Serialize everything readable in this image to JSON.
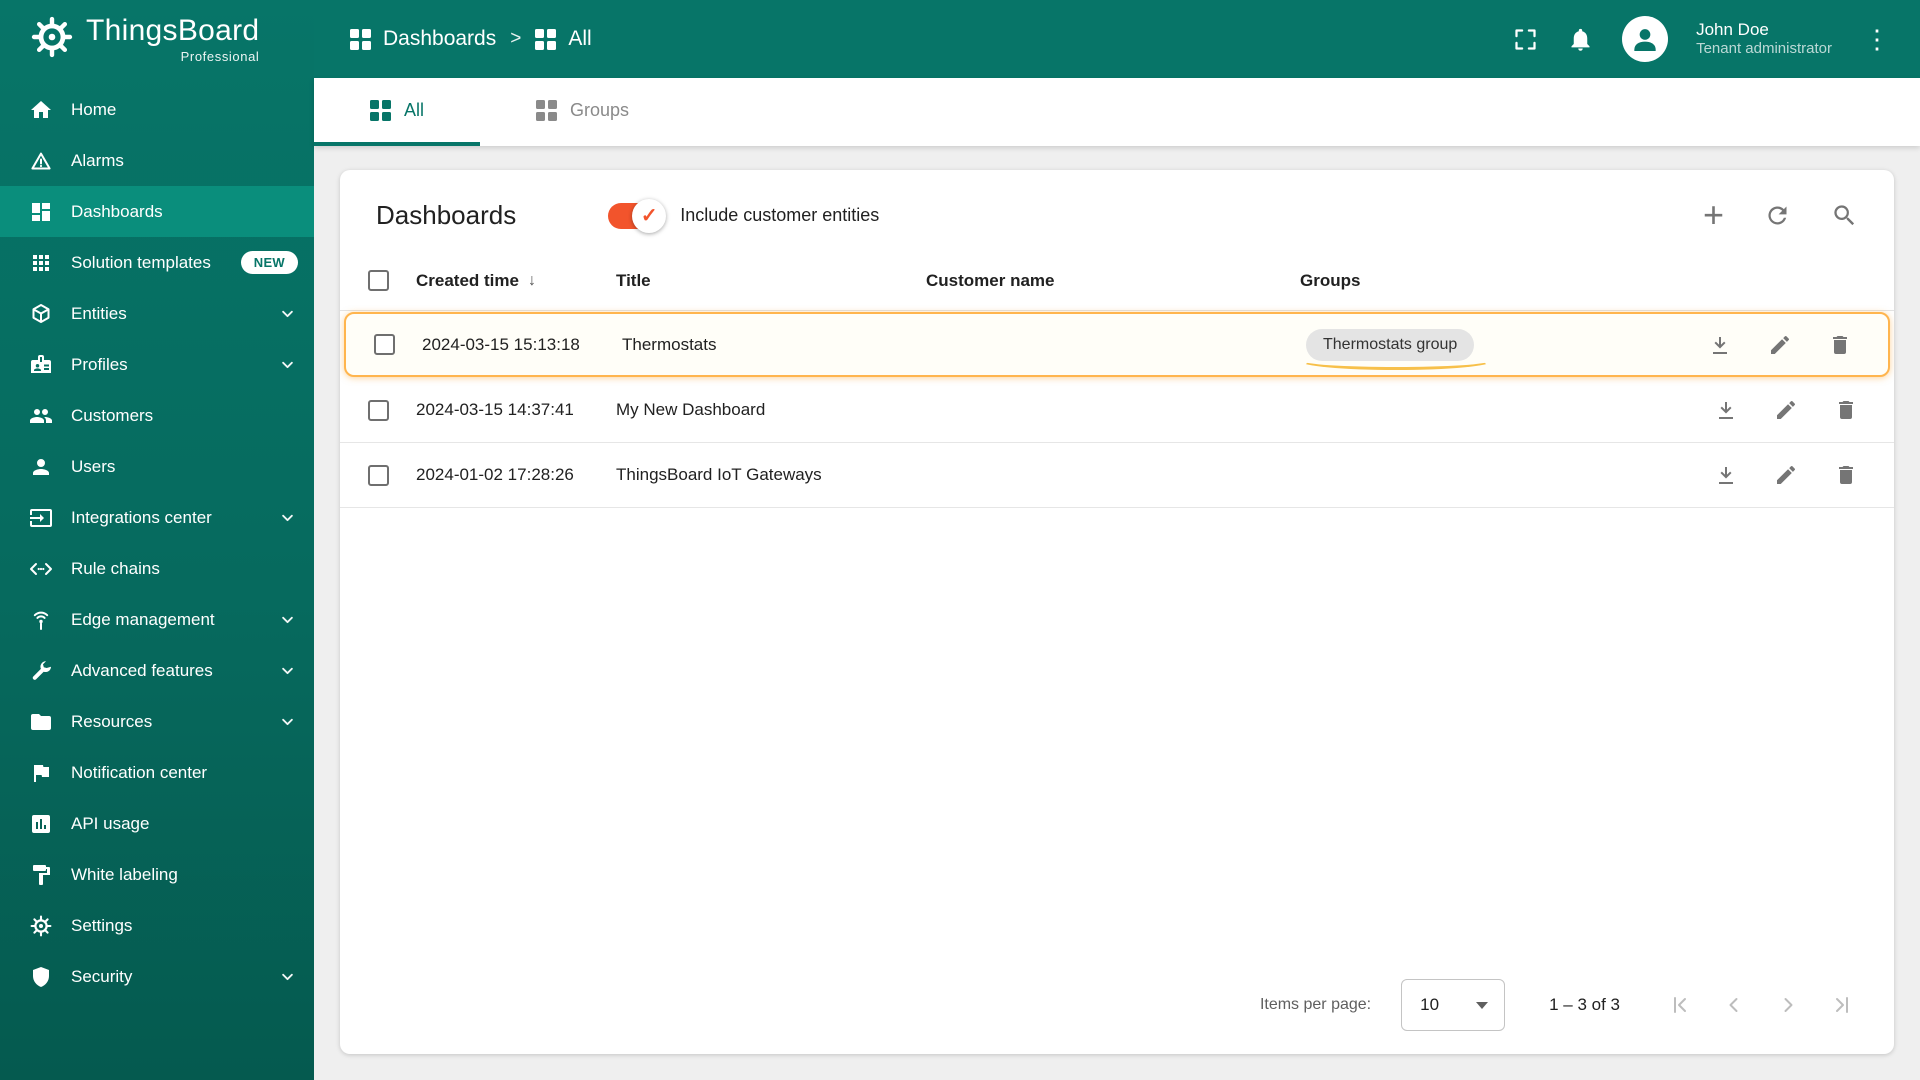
{
  "app": {
    "name": "ThingsBoard",
    "edition": "Professional"
  },
  "header": {
    "breadcrumb": [
      {
        "label": "Dashboards"
      },
      {
        "label": "All"
      }
    ],
    "user": {
      "name": "John Doe",
      "role": "Tenant administrator"
    }
  },
  "sidebar": {
    "items": [
      {
        "label": "Home",
        "icon": "home-icon"
      },
      {
        "label": "Alarms",
        "icon": "alarms-icon"
      },
      {
        "label": "Dashboards",
        "icon": "dashboards-icon",
        "active": true
      },
      {
        "label": "Solution templates",
        "icon": "solution-templates-icon",
        "badge": "NEW"
      },
      {
        "label": "Entities",
        "icon": "entities-icon",
        "expandable": true
      },
      {
        "label": "Profiles",
        "icon": "profiles-icon",
        "expandable": true
      },
      {
        "label": "Customers",
        "icon": "customers-icon"
      },
      {
        "label": "Users",
        "icon": "users-icon"
      },
      {
        "label": "Integrations center",
        "icon": "integrations-icon",
        "expandable": true
      },
      {
        "label": "Rule chains",
        "icon": "rule-chains-icon"
      },
      {
        "label": "Edge management",
        "icon": "edge-management-icon",
        "expandable": true
      },
      {
        "label": "Advanced features",
        "icon": "advanced-features-icon",
        "expandable": true
      },
      {
        "label": "Resources",
        "icon": "resources-icon",
        "expandable": true
      },
      {
        "label": "Notification center",
        "icon": "notification-center-icon"
      },
      {
        "label": "API usage",
        "icon": "api-usage-icon"
      },
      {
        "label": "White labeling",
        "icon": "white-labeling-icon"
      },
      {
        "label": "Settings",
        "icon": "settings-icon"
      },
      {
        "label": "Security",
        "icon": "security-icon",
        "expandable": true
      }
    ]
  },
  "tabs": [
    {
      "label": "All",
      "active": true
    },
    {
      "label": "Groups",
      "active": false
    }
  ],
  "main": {
    "title": "Dashboards",
    "toggle": {
      "label": "Include customer entities",
      "checked": true
    },
    "table": {
      "columns": {
        "created": "Created time",
        "title": "Title",
        "customer": "Customer name",
        "groups": "Groups"
      },
      "rows": [
        {
          "created": "2024-03-15 15:13:18",
          "title": "Thermostats",
          "customer": "",
          "group": "Thermostats group",
          "highlighted": true
        },
        {
          "created": "2024-03-15 14:37:41",
          "title": "My New Dashboard",
          "customer": "",
          "group": ""
        },
        {
          "created": "2024-01-02 17:28:26",
          "title": "ThingsBoard IoT Gateways",
          "customer": "",
          "group": ""
        }
      ]
    },
    "pagination": {
      "items_per_page_label": "Items per page:",
      "items_per_page": "10",
      "range": "1 – 3 of 3"
    }
  },
  "colors": {
    "primary": "#077568",
    "sidebar_active": "#0A8E7C",
    "accent_toggle": "#F2542C",
    "highlight_border": "#FFB54E"
  }
}
